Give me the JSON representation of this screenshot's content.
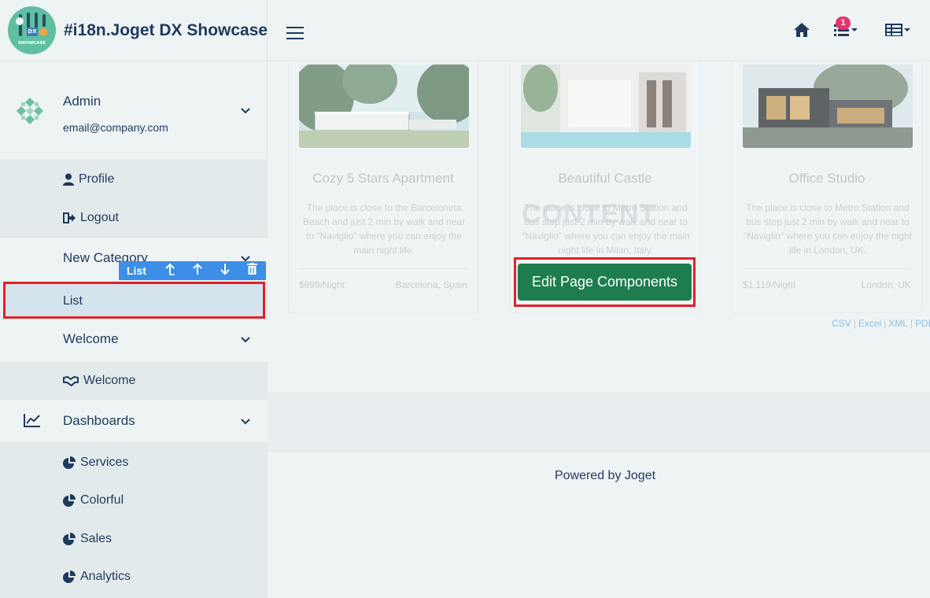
{
  "app": {
    "title": "#i18n.Joget DX Showcase",
    "logo_dx": "DX",
    "logo_showcase": "SHOWCASE"
  },
  "user": {
    "name": "Admin",
    "email": "email@company.com"
  },
  "user_menu": [
    {
      "label": "Profile",
      "icon": "user-icon"
    },
    {
      "label": "Logout",
      "icon": "logout-icon"
    }
  ],
  "sidebar": {
    "category": "New Category",
    "list_item": "List",
    "welcome_group": "Welcome",
    "welcome_item": "Welcome",
    "dashboards_group": "Dashboards",
    "dashboard_items": [
      "Services",
      "Colorful",
      "Sales",
      "Analytics"
    ]
  },
  "toolbar": {
    "label": "List",
    "buttons": [
      "move-up-level-icon",
      "move-up-icon",
      "move-down-icon",
      "delete-icon"
    ]
  },
  "header": {
    "notification_count": "1"
  },
  "cards": [
    {
      "title": "Cozy 5 Stars Apartment",
      "desc": "The place is close to the Barceloneta Beach and just 2 min by walk and near to \"Naviglio\" where you can enjoy the main night life.",
      "price": "$899/Night",
      "location": "Barcelona, Spain"
    },
    {
      "title": "Beautiful Castle",
      "desc": "The place is close to Metro Station and bus stop just 2 min by walk and near to \"Naviglio\" where you can enjoy the main night life in Milan, Italy.",
      "price": "",
      "location": ""
    },
    {
      "title": "Office Studio",
      "desc": "The place is close to Metro Station and bus stop just 2 min by walk and near to \"Naviglio\" where you can enjoy the night life in London, UK.",
      "price": "$1,119/Night",
      "location": "London, UK"
    }
  ],
  "watermark": "CONTENT",
  "edit_button": "Edit Page Components",
  "exports": [
    "CSV",
    "Excel",
    "XML",
    "PDF"
  ],
  "footer": {
    "powered": "Powered by Joget"
  },
  "colors": {
    "accent": "#1e3a5c",
    "highlight": "#e3202a",
    "toolbar": "#3d8ee6",
    "edit_button": "#1e7d4f",
    "badge": "#e5336b"
  }
}
